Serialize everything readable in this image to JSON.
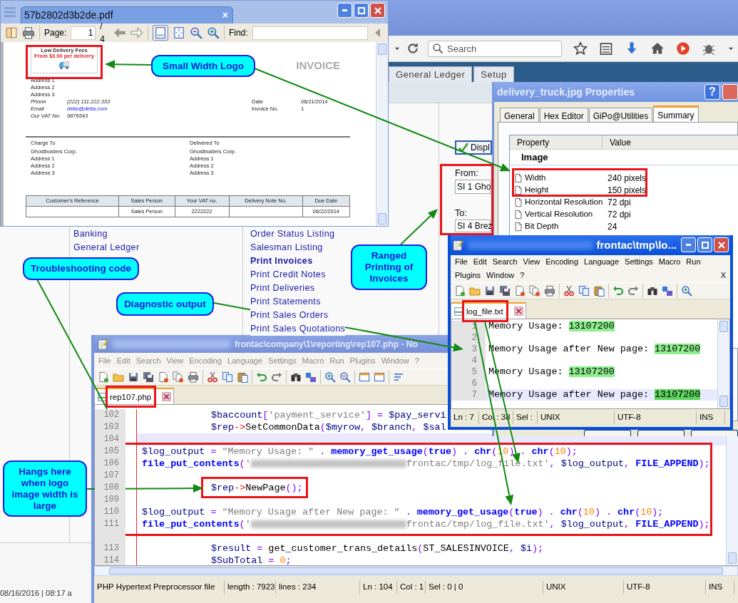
{
  "browser": {
    "search_placeholder": "Search",
    "app_tabs": [
      {
        "label": "General Ledger",
        "selected": false
      },
      {
        "label": "Setup",
        "selected": false
      }
    ],
    "nav_links": [
      "Banking",
      "General Ledger"
    ],
    "report_links": [
      {
        "label": "Order Status Listing",
        "selected": false
      },
      {
        "label": "Salesman Listing",
        "selected": false
      },
      {
        "label": "Print Invoices",
        "selected": true
      },
      {
        "label": "Print Credit Notes",
        "selected": false
      },
      {
        "label": "Print Deliveries",
        "selected": false
      },
      {
        "label": "Print Statements",
        "selected": false
      },
      {
        "label": "Print Sales Orders",
        "selected": false
      },
      {
        "label": "Print Sales Quotations",
        "selected": false
      }
    ],
    "display_button": "Displ",
    "range": {
      "from_label": "From:",
      "from_value": "SI 1 Gho",
      "to_label": "To:",
      "to_value": "SI 4 Brez"
    },
    "footer": "08/16/2016 | 08:17 a"
  },
  "pdf_viewer": {
    "title": "57b2802d3b2de.pdf",
    "close_tab": "×",
    "page_label": "Page:",
    "page_value": "1",
    "page_total": "/ 4",
    "find_label": "Find:",
    "invoice": {
      "logo_lines": [
        "Low Delivery Fees",
        "From $3.00 per delivery"
      ],
      "heading": "INVOICE",
      "address": [
        "Address 1",
        "Address 2",
        "Address 3"
      ],
      "contact": [
        {
          "label": "Phone",
          "value": "(222) 111.222.333",
          "kind": "text"
        },
        {
          "label": "Email",
          "value": "delta@delta.com",
          "kind": "link"
        },
        {
          "label": "Our VAT No.",
          "value": "9876543",
          "kind": "text"
        }
      ],
      "meta": [
        {
          "label": "Date",
          "value": "06/21/2014"
        },
        {
          "label": "Invoice No.",
          "value": "1"
        }
      ],
      "parties": [
        {
          "caption": "Charge To",
          "lines": [
            "Ghostbusters Corp.",
            "Address 1",
            "Address 2",
            "Address 3"
          ]
        },
        {
          "caption": "Delivered To",
          "lines": [
            "Ghostbusters Corp.",
            "Address 1",
            "Address 2",
            "Address 3"
          ]
        }
      ],
      "table": {
        "columns": [
          "Customer's Reference",
          "Sales Person",
          "Your VAT no.",
          "Delivery Note No.",
          "Due Date"
        ],
        "rows": [
          [
            null,
            "Sales Person",
            "2222222",
            null,
            "06/22/2014"
          ]
        ]
      }
    }
  },
  "properties_dialog": {
    "title": "delivery_truck.jpg Properties",
    "help": "?",
    "tabs": [
      {
        "label": "General",
        "selected": false
      },
      {
        "label": "Hex Editor",
        "selected": false
      },
      {
        "label": "GiPo@Utilities",
        "selected": false
      },
      {
        "label": "Summary",
        "selected": true
      }
    ],
    "columns": [
      "Property",
      "Value"
    ],
    "group": "Image",
    "rows": [
      {
        "property": "Width",
        "value": "240 pixels"
      },
      {
        "property": "Height",
        "value": "150 pixels"
      },
      {
        "property": "Horizontal Resolution",
        "value": "72 dpi"
      },
      {
        "property": "Vertical Resolution",
        "value": "72 dpi"
      },
      {
        "property": "Bit Depth",
        "value": "24"
      }
    ]
  },
  "php_editor": {
    "title": "frontac\\company\\1\\reporting\\rep107.php - No",
    "menu": [
      "File",
      "Edit",
      "Search",
      "View",
      "Encoding",
      "Language",
      "Settings",
      "Macro",
      "Run",
      "Plugins",
      "Window",
      "?"
    ],
    "tab": "rep107.php",
    "lines": [
      {
        "number": "102",
        "indent": true,
        "current": false,
        "segments": [
          {
            "kind": "var",
            "text": "$baccount"
          },
          {
            "kind": "op",
            "text": "["
          },
          {
            "kind": "str",
            "text": "'payment_service'"
          },
          {
            "kind": "op",
            "text": "] = "
          },
          {
            "kind": "var",
            "text": "$pay_servi"
          }
        ]
      },
      {
        "number": "103",
        "indent": true,
        "current": false,
        "segments": [
          {
            "kind": "var",
            "text": "$rep"
          },
          {
            "kind": "arrow",
            "text": "->"
          },
          {
            "kind": "plain",
            "text": "SetCommonData"
          },
          {
            "kind": "op",
            "text": "("
          },
          {
            "kind": "var",
            "text": "$myrow"
          },
          {
            "kind": "op",
            "text": ", "
          },
          {
            "kind": "var",
            "text": "$branch"
          },
          {
            "kind": "op",
            "text": ", "
          },
          {
            "kind": "var",
            "text": "$sal"
          }
        ]
      },
      {
        "number": "104",
        "current": true
      },
      {
        "number": "105",
        "current": false,
        "segments": [
          {
            "kind": "var",
            "text": "$log_output"
          },
          {
            "kind": "op",
            "text": " = "
          },
          {
            "kind": "str",
            "text": "\"Memory Usage: \""
          },
          {
            "kind": "op",
            "text": " . "
          },
          {
            "kind": "fn",
            "text": "memory_get_usage"
          },
          {
            "kind": "op",
            "text": "("
          },
          {
            "kind": "fn",
            "text": "true"
          },
          {
            "kind": "op",
            "text": ") . "
          },
          {
            "kind": "fn",
            "text": "chr"
          },
          {
            "kind": "op",
            "text": "("
          },
          {
            "kind": "num",
            "text": "10"
          },
          {
            "kind": "op",
            "text": ") . "
          },
          {
            "kind": "fn",
            "text": "chr"
          },
          {
            "kind": "op",
            "text": "("
          },
          {
            "kind": "num",
            "text": "10"
          },
          {
            "kind": "op",
            "text": ");"
          }
        ]
      },
      {
        "number": "106",
        "current": false,
        "segments": [
          {
            "kind": "fn",
            "text": "file_put_contents"
          },
          {
            "kind": "op",
            "text": "("
          },
          {
            "kind": "str",
            "text": "'"
          },
          {
            "kind": "redacted"
          },
          {
            "kind": "str",
            "text": "frontac/tmp/log_file.txt'"
          },
          {
            "kind": "op",
            "text": ", "
          },
          {
            "kind": "var",
            "text": "$log_output"
          },
          {
            "kind": "op",
            "text": ", "
          },
          {
            "kind": "fn",
            "text": "FILE_APPEND"
          },
          {
            "kind": "op",
            "text": ");"
          }
        ]
      },
      {
        "number": "107",
        "current": false
      },
      {
        "number": "108",
        "indent": true,
        "current": false,
        "segments": [
          {
            "kind": "var",
            "text": "$rep"
          },
          {
            "kind": "arrow",
            "text": "->"
          },
          {
            "kind": "plain",
            "text": "NewPage"
          },
          {
            "kind": "op",
            "text": "();"
          }
        ]
      },
      {
        "number": "109",
        "current": false
      },
      {
        "number": "110",
        "current": false,
        "segments": [
          {
            "kind": "var",
            "text": "$log_output"
          },
          {
            "kind": "op",
            "text": " = "
          },
          {
            "kind": "str",
            "text": "\"Memory Usage after New page: \""
          },
          {
            "kind": "op",
            "text": " . "
          },
          {
            "kind": "fn",
            "text": "memory_get_usage"
          },
          {
            "kind": "op",
            "text": "("
          },
          {
            "kind": "fn",
            "text": "true"
          },
          {
            "kind": "op",
            "text": ") . "
          },
          {
            "kind": "fn",
            "text": "chr"
          },
          {
            "kind": "op",
            "text": "("
          },
          {
            "kind": "num",
            "text": "10"
          },
          {
            "kind": "op",
            "text": ") . "
          },
          {
            "kind": "fn",
            "text": "chr"
          },
          {
            "kind": "op",
            "text": "("
          },
          {
            "kind": "num",
            "text": "10"
          },
          {
            "kind": "op",
            "text": ");"
          }
        ]
      },
      {
        "number": "111",
        "current": false,
        "segments": [
          {
            "kind": "fn",
            "text": "file_put_contents"
          },
          {
            "kind": "op",
            "text": "("
          },
          {
            "kind": "str",
            "text": "'"
          },
          {
            "kind": "redacted"
          },
          {
            "kind": "str",
            "text": "frontac/tmp/log_file.txt'"
          },
          {
            "kind": "op",
            "text": ", "
          },
          {
            "kind": "var",
            "text": "$log_output"
          },
          {
            "kind": "op",
            "text": ", "
          },
          {
            "kind": "fn",
            "text": "FILE_APPEND"
          },
          {
            "kind": "op",
            "text": ");"
          }
        ]
      },
      {
        "current": false
      },
      {
        "number": "113",
        "indent": true,
        "current": false,
        "segments": [
          {
            "kind": "var",
            "text": "$result"
          },
          {
            "kind": "op",
            "text": " = "
          },
          {
            "kind": "plain",
            "text": "get_customer_trans_details"
          },
          {
            "kind": "op",
            "text": "("
          },
          {
            "kind": "plain",
            "text": "ST_SALESINVOICE"
          },
          {
            "kind": "op",
            "text": ", "
          },
          {
            "kind": "var",
            "text": "$i"
          },
          {
            "kind": "op",
            "text": ");"
          }
        ]
      },
      {
        "number": "114",
        "indent": true,
        "current": false,
        "segments": [
          {
            "kind": "var",
            "text": "$SubTotal"
          },
          {
            "kind": "op",
            "text": " = "
          },
          {
            "kind": "num",
            "text": "0"
          },
          {
            "kind": "op",
            "text": ";"
          }
        ]
      }
    ],
    "status": [
      "PHP Hypertext Preprocessor file",
      "length : 7923",
      "lines : 234",
      "Ln : 104",
      "Col : 1",
      "Sel : 0 | 0",
      "UNIX",
      "UTF-8",
      "INS"
    ]
  },
  "log_editor": {
    "title": "frontac\\tmp\\lo...",
    "menu": [
      "File",
      "Edit",
      "Search",
      "View",
      "Encoding",
      "Language",
      "Settings",
      "Macro",
      "Run",
      "Plugins",
      "Window",
      "?"
    ],
    "close_doc": "X",
    "tab": "log_file.txt",
    "lines": [
      {
        "number": "1",
        "current": false,
        "segments": [
          {
            "kind": "plain",
            "text": "Memory Usage: "
          },
          {
            "kind": "match",
            "text": "13107200"
          }
        ]
      },
      {
        "number": "2",
        "current": false
      },
      {
        "number": "3",
        "current": false,
        "segments": [
          {
            "kind": "plain",
            "text": "Memory Usage after New page: "
          },
          {
            "kind": "match",
            "text": "13107200"
          }
        ]
      },
      {
        "number": "4",
        "current": false
      },
      {
        "number": "5",
        "current": false,
        "segments": [
          {
            "kind": "plain",
            "text": "Memory Usage: "
          },
          {
            "kind": "match",
            "text": "13107200"
          }
        ]
      },
      {
        "number": "6",
        "current": false
      },
      {
        "number": "7",
        "current": true,
        "segments": [
          {
            "kind": "plain",
            "text": "Memory Usage after New page: "
          },
          {
            "kind": "match_selected",
            "text": "13107200"
          }
        ]
      }
    ],
    "status": [
      "Ln : 7",
      "Col : 38",
      "Sel :",
      "UNIX",
      "UTF-8",
      "INS"
    ]
  },
  "callouts": [
    "Small Width Logo",
    "Troubleshooting code",
    "Ranged Printing of Invoices",
    "Diagnostic output",
    "Hangs here when logo image width is large"
  ]
}
